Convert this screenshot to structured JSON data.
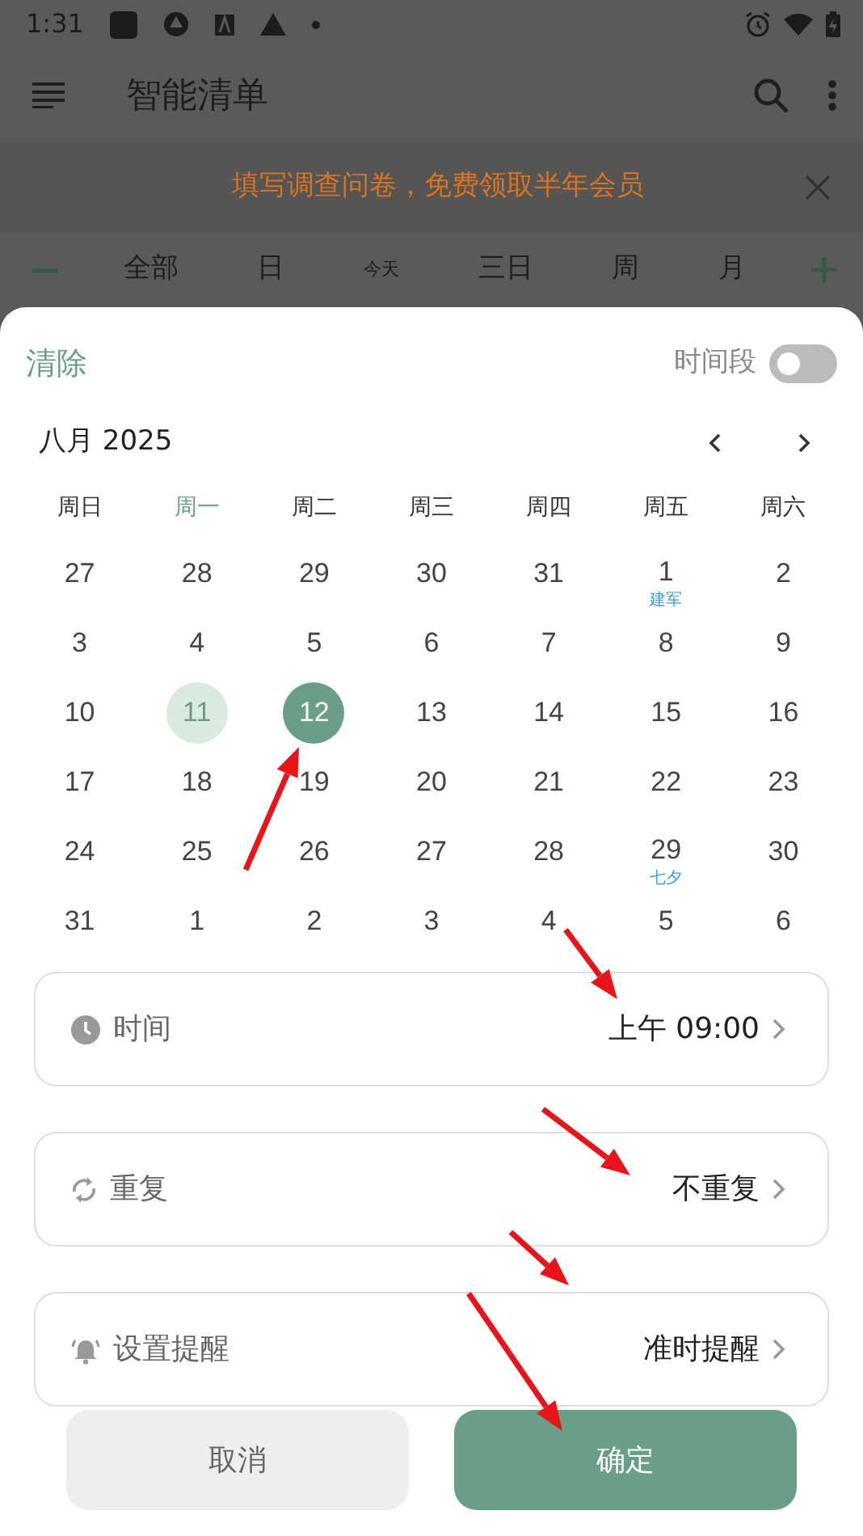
{
  "status_bar": {
    "time": "1:31"
  },
  "app_bar": {
    "title": "智能清单"
  },
  "banner": {
    "text": "填写调查问卷，免费领取半年会员"
  },
  "view_tabs": [
    {
      "label": "全部",
      "kind": "tab"
    },
    {
      "label": "日",
      "kind": "tab"
    },
    {
      "label": "今天",
      "kind": "small"
    },
    {
      "label": "三日",
      "kind": "tab"
    },
    {
      "label": "周",
      "kind": "tab"
    },
    {
      "label": "月",
      "kind": "tab"
    }
  ],
  "sheet": {
    "clear_label": "清除",
    "range_label": "时间段",
    "range_on": false,
    "month_title": "八月 2025",
    "weekdays": [
      {
        "label": "周日",
        "highlighted": false
      },
      {
        "label": "周一",
        "highlighted": true
      },
      {
        "label": "周二",
        "highlighted": false
      },
      {
        "label": "周三",
        "highlighted": false
      },
      {
        "label": "周四",
        "highlighted": false
      },
      {
        "label": "周五",
        "highlighted": false
      },
      {
        "label": "周六",
        "highlighted": false
      }
    ],
    "weeks": [
      [
        {
          "day": "27",
          "today": false,
          "selected": false
        },
        {
          "day": "28",
          "today": false,
          "selected": false
        },
        {
          "day": "29",
          "today": false,
          "selected": false
        },
        {
          "day": "30",
          "today": false,
          "selected": false
        },
        {
          "day": "31",
          "today": false,
          "selected": false
        },
        {
          "day": "1",
          "note": "建军",
          "today": false,
          "selected": false
        },
        {
          "day": "2",
          "today": false,
          "selected": false
        }
      ],
      [
        {
          "day": "3",
          "today": false,
          "selected": false
        },
        {
          "day": "4",
          "today": false,
          "selected": false
        },
        {
          "day": "5",
          "today": false,
          "selected": false
        },
        {
          "day": "6",
          "today": false,
          "selected": false
        },
        {
          "day": "7",
          "today": false,
          "selected": false
        },
        {
          "day": "8",
          "today": false,
          "selected": false
        },
        {
          "day": "9",
          "today": false,
          "selected": false
        }
      ],
      [
        {
          "day": "10",
          "today": false,
          "selected": false
        },
        {
          "day": "11",
          "today": true,
          "selected": false
        },
        {
          "day": "12",
          "today": false,
          "selected": true
        },
        {
          "day": "13",
          "today": false,
          "selected": false
        },
        {
          "day": "14",
          "today": false,
          "selected": false
        },
        {
          "day": "15",
          "today": false,
          "selected": false
        },
        {
          "day": "16",
          "today": false,
          "selected": false
        }
      ],
      [
        {
          "day": "17",
          "today": false,
          "selected": false
        },
        {
          "day": "18",
          "today": false,
          "selected": false
        },
        {
          "day": "19",
          "today": false,
          "selected": false
        },
        {
          "day": "20",
          "today": false,
          "selected": false
        },
        {
          "day": "21",
          "today": false,
          "selected": false
        },
        {
          "day": "22",
          "today": false,
          "selected": false
        },
        {
          "day": "23",
          "today": false,
          "selected": false
        }
      ],
      [
        {
          "day": "24",
          "today": false,
          "selected": false
        },
        {
          "day": "25",
          "today": false,
          "selected": false
        },
        {
          "day": "26",
          "today": false,
          "selected": false
        },
        {
          "day": "27",
          "today": false,
          "selected": false
        },
        {
          "day": "28",
          "today": false,
          "selected": false
        },
        {
          "day": "29",
          "note": "七夕",
          "today": false,
          "selected": false
        },
        {
          "day": "30",
          "today": false,
          "selected": false
        }
      ],
      [
        {
          "day": "31",
          "today": false,
          "selected": false
        },
        {
          "day": "1",
          "today": false,
          "selected": false
        },
        {
          "day": "2",
          "today": false,
          "selected": false
        },
        {
          "day": "3",
          "today": false,
          "selected": false
        },
        {
          "day": "4",
          "today": false,
          "selected": false
        },
        {
          "day": "5",
          "today": false,
          "selected": false
        },
        {
          "day": "6",
          "today": false,
          "selected": false
        }
      ]
    ]
  },
  "settings": [
    {
      "kind": "time",
      "label": "时间",
      "value": "上午 09:00"
    },
    {
      "kind": "repeat",
      "label": "重复",
      "value": "不重复"
    },
    {
      "kind": "reminder",
      "label": "设置提醒",
      "value": "准时提醒"
    }
  ],
  "buttons": [
    {
      "kind": "cancel",
      "label": "取消"
    },
    {
      "kind": "confirm",
      "label": "确定"
    }
  ]
}
